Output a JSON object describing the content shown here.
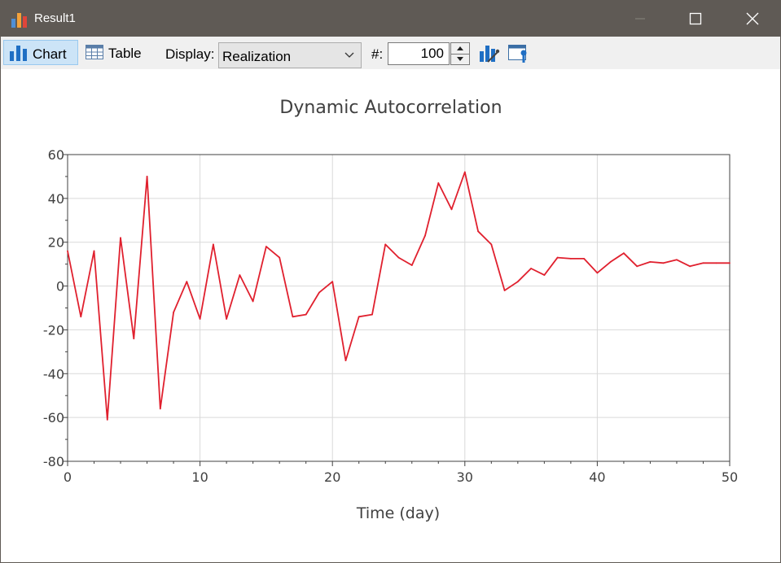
{
  "window": {
    "title": "Result1"
  },
  "toolbar": {
    "chart_label": "Chart",
    "table_label": "Table",
    "display_label": "Display:",
    "display_value": "Realization",
    "hash_label": "#:",
    "realization_number": "100"
  },
  "colors": {
    "series": "#e0202e",
    "titlebar": "#5f5a55",
    "grid": "#d9d9d9"
  },
  "icons": {
    "app": "bar-chart-icon",
    "chart": "bar-chart-icon",
    "table": "table-icon",
    "chart_properties": "chart-properties-icon",
    "window_properties": "window-properties-icon"
  },
  "chart_data": {
    "type": "line",
    "title": "Dynamic Autocorrelation",
    "xlabel": "Time (day)",
    "ylabel": "",
    "xlim": [
      0,
      50
    ],
    "ylim": [
      -80,
      60
    ],
    "xticks": [
      0,
      10,
      20,
      30,
      40,
      50
    ],
    "yticks": [
      60,
      40,
      20,
      0,
      -20,
      -40,
      -60,
      -80
    ],
    "grid": true,
    "legend": "none",
    "series": [
      {
        "x": [
          0,
          1,
          2,
          3,
          4,
          5,
          6,
          7,
          8,
          9,
          10,
          11,
          12,
          13,
          14,
          15,
          16,
          17,
          18,
          19,
          20,
          21,
          22,
          23,
          24,
          25,
          26,
          27,
          28,
          29,
          30,
          31,
          32,
          33,
          34,
          35,
          36,
          37,
          38,
          39,
          40,
          41,
          42,
          43,
          44,
          45,
          46,
          47,
          48,
          49,
          50
        ],
        "values": [
          16,
          -14,
          16,
          -61,
          22,
          -24,
          50,
          -56,
          -12,
          2,
          -15,
          19,
          -15,
          5,
          -7,
          18,
          13,
          -14,
          -13,
          -3,
          2,
          -34,
          -14,
          -13,
          19,
          13,
          9.5,
          23,
          47,
          35,
          52,
          25,
          19,
          -2,
          2,
          8,
          5,
          13,
          12.5,
          12.5,
          6,
          11,
          15,
          9,
          11,
          10.5,
          12,
          9,
          10.5,
          10.5,
          10.5
        ]
      }
    ]
  }
}
